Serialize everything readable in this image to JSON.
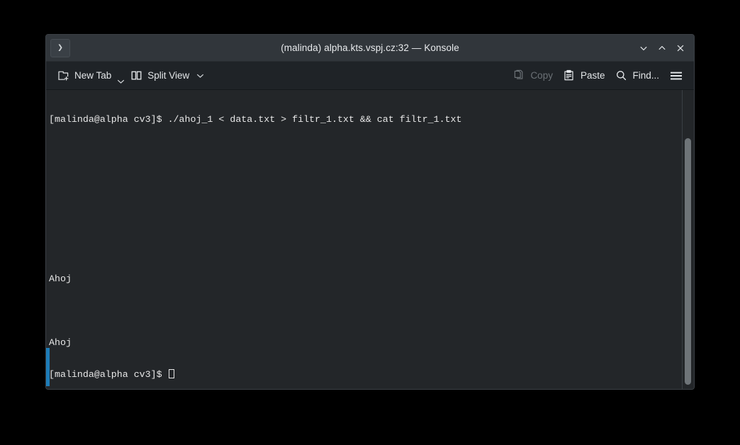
{
  "window": {
    "title": "(malinda) alpha.kts.vspj.cz:32 — Konsole",
    "app_icon_glyph": "❯",
    "controls": {
      "minimize_label": "Minimize",
      "maximize_label": "Maximize",
      "close_label": "Close"
    }
  },
  "toolbar": {
    "new_tab_label": "New Tab",
    "split_view_label": "Split View",
    "copy_label": "Copy",
    "paste_label": "Paste",
    "find_label": "Find...",
    "menu_label": "Menu"
  },
  "terminal": {
    "lines": [
      "[malinda@alpha cv3]$ ./ahoj_1 < data.txt > filtr_1.txt && cat filtr_1.txt",
      "",
      "",
      "",
      "",
      "Ahoj",
      "",
      "Ahoj"
    ],
    "prompt": "[malinda@alpha cv3]$ ",
    "cursor": "block-cursor"
  },
  "colors": {
    "titlebar_bg": "#31363b",
    "toolbar_bg": "#1f2327",
    "terminal_bg": "#232629",
    "terminal_fg": "#e8e8e8",
    "accent_marker": "#1d7cb8",
    "scrollbar_thumb": "#6e7478",
    "disabled_fg": "#6b7176"
  }
}
